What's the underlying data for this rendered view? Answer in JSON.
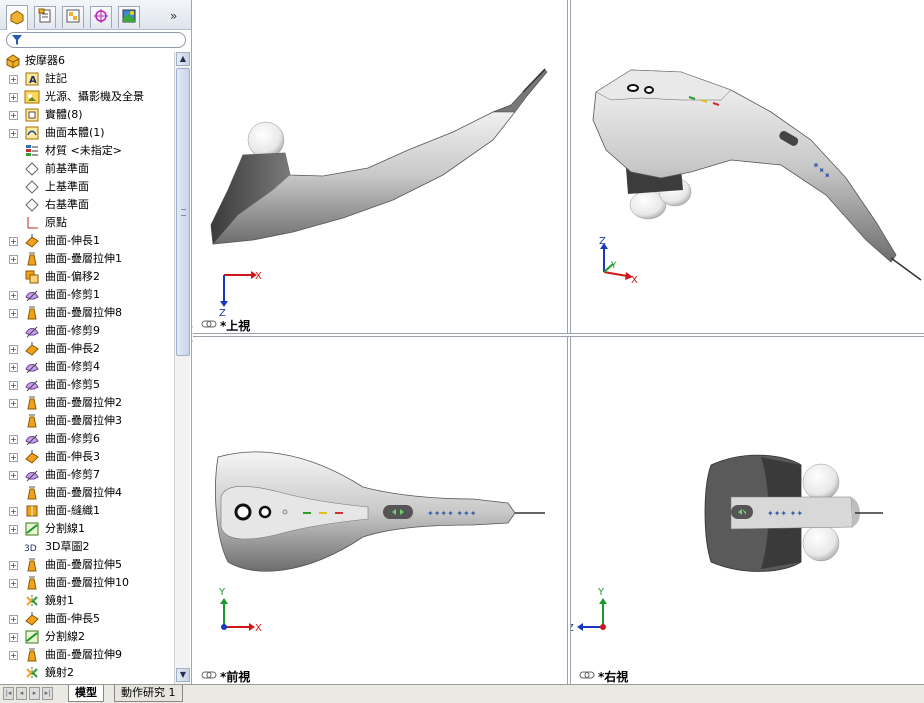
{
  "panel_tabs": [
    {
      "name": "feature-manager-tab",
      "icon": "feature-tree-icon",
      "active": true
    },
    {
      "name": "property-manager-tab",
      "icon": "property-manager-icon"
    },
    {
      "name": "configuration-manager-tab",
      "icon": "configuration-manager-icon"
    },
    {
      "name": "dimxpert-tab",
      "icon": "crosshair-icon"
    },
    {
      "name": "display-manager-tab",
      "icon": "display-manager-icon"
    }
  ],
  "tree": {
    "root": "按摩器6",
    "items": [
      {
        "label": "註記",
        "icon": "annotation-icon",
        "expand": true
      },
      {
        "label": "光源、攝影機及全景",
        "icon": "lights-camera-icon",
        "expand": true
      },
      {
        "label": "實體(8)",
        "icon": "solid-bodies-icon",
        "expand": true
      },
      {
        "label": "曲面本體(1)",
        "icon": "surface-bodies-icon",
        "expand": true
      },
      {
        "label": "材質 <未指定>",
        "icon": "material-icon",
        "expand": false
      },
      {
        "label": "前基準面",
        "icon": "plane-icon",
        "expand": false
      },
      {
        "label": "上基準面",
        "icon": "plane-icon",
        "expand": false
      },
      {
        "label": "右基準面",
        "icon": "plane-icon",
        "expand": false
      },
      {
        "label": "原點",
        "icon": "origin-icon",
        "expand": false
      },
      {
        "label": "曲面-伸長1",
        "icon": "surface-extrude-icon",
        "expand": true
      },
      {
        "label": "曲面-疊層拉伸1",
        "icon": "surface-loft-icon",
        "expand": true
      },
      {
        "label": "曲面-偏移2",
        "icon": "surface-offset-icon",
        "expand": false
      },
      {
        "label": "曲面-修剪1",
        "icon": "surface-trim-icon",
        "expand": true
      },
      {
        "label": "曲面-疊層拉伸8",
        "icon": "surface-loft-icon",
        "expand": true
      },
      {
        "label": "曲面-修剪9",
        "icon": "surface-trim-icon",
        "expand": false
      },
      {
        "label": "曲面-伸長2",
        "icon": "surface-extrude-icon",
        "expand": true
      },
      {
        "label": "曲面-修剪4",
        "icon": "surface-trim-icon",
        "expand": true
      },
      {
        "label": "曲面-修剪5",
        "icon": "surface-trim-icon",
        "expand": true
      },
      {
        "label": "曲面-疊層拉伸2",
        "icon": "surface-loft-icon",
        "expand": true
      },
      {
        "label": "曲面-疊層拉伸3",
        "icon": "surface-loft-icon",
        "expand": false
      },
      {
        "label": "曲面-修剪6",
        "icon": "surface-trim-icon",
        "expand": true
      },
      {
        "label": "曲面-伸長3",
        "icon": "surface-extrude-icon",
        "expand": true
      },
      {
        "label": "曲面-修剪7",
        "icon": "surface-trim-icon",
        "expand": true
      },
      {
        "label": "曲面-疊層拉伸4",
        "icon": "surface-loft-icon",
        "expand": false
      },
      {
        "label": "曲面-縫織1",
        "icon": "surface-knit-icon",
        "expand": true
      },
      {
        "label": "分割線1",
        "icon": "split-line-icon",
        "expand": true
      },
      {
        "label": "3D草圖2",
        "icon": "sketch-3d-icon",
        "expand": false
      },
      {
        "label": "曲面-疊層拉伸5",
        "icon": "surface-loft-icon",
        "expand": true
      },
      {
        "label": "曲面-疊層拉伸10",
        "icon": "surface-loft-icon",
        "expand": true
      },
      {
        "label": "鏡射1",
        "icon": "mirror-icon",
        "expand": false
      },
      {
        "label": "曲面-伸長5",
        "icon": "surface-extrude-icon",
        "expand": true
      },
      {
        "label": "分割線2",
        "icon": "split-line-icon",
        "expand": true
      },
      {
        "label": "曲面-疊層拉伸9",
        "icon": "surface-loft-icon",
        "expand": true
      },
      {
        "label": "鏡射2",
        "icon": "mirror-icon",
        "expand": false
      }
    ]
  },
  "bottom_tabs": [
    {
      "label": "模型",
      "active": true
    },
    {
      "label": "動作研究 1",
      "active": false
    }
  ],
  "viewports": {
    "top": {
      "label": "*上視",
      "axes": [
        "X",
        "Z"
      ]
    },
    "iso": {
      "label": "",
      "axes": [
        "Z",
        "Y",
        "X"
      ]
    },
    "front": {
      "label": "*前視",
      "axes": [
        "Y",
        "X"
      ]
    },
    "right": {
      "label": "*右視",
      "axes": [
        "Y",
        "Z"
      ]
    }
  },
  "colors": {
    "axis_x": "#d01818",
    "axis_y": "#1a9a2a",
    "axis_z": "#1838c0",
    "feature_orange": "#f2a21a",
    "selection_blue": "#3a5fa8"
  }
}
